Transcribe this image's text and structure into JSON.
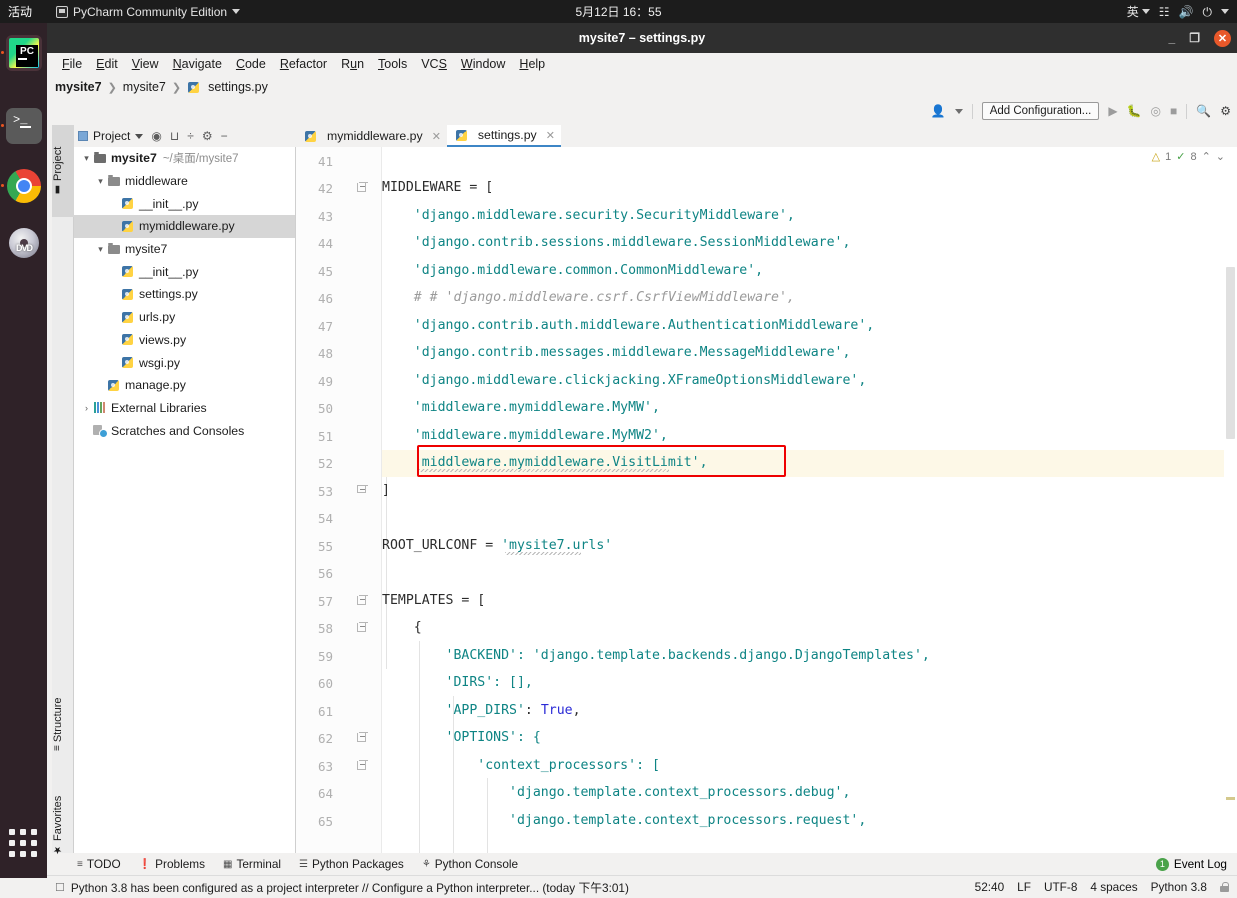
{
  "gnome": {
    "activities": "活动",
    "app_name": "PyCharm Community Edition",
    "clock": "5月12日 16：55",
    "input_method": "英",
    "icons": [
      "network-icon",
      "volume-icon",
      "power-icon"
    ]
  },
  "dock": {
    "items": [
      {
        "name": "pycharm",
        "label": "PC"
      },
      {
        "name": "terminal",
        "label": ">_"
      },
      {
        "name": "chrome",
        "label": ""
      },
      {
        "name": "dvd",
        "label": "DVD"
      }
    ],
    "show_apps": "show-applications"
  },
  "window": {
    "title": "mysite7 – settings.py",
    "minimize": "_",
    "maximize": "❐",
    "close": "✕"
  },
  "menubar": [
    {
      "label": "File",
      "mnemonic": "F"
    },
    {
      "label": "Edit",
      "mnemonic": "E"
    },
    {
      "label": "View",
      "mnemonic": "V"
    },
    {
      "label": "Navigate",
      "mnemonic": "N"
    },
    {
      "label": "Code",
      "mnemonic": "C"
    },
    {
      "label": "Refactor",
      "mnemonic": "R"
    },
    {
      "label": "Run",
      "mnemonic": "u"
    },
    {
      "label": "Tools",
      "mnemonic": "T"
    },
    {
      "label": "VCS",
      "mnemonic": "S"
    },
    {
      "label": "Window",
      "mnemonic": "W"
    },
    {
      "label": "Help",
      "mnemonic": "H"
    }
  ],
  "breadcrumb": [
    "mysite7",
    "mysite7",
    "settings.py"
  ],
  "toolbar": {
    "add_configuration": "Add Configuration...",
    "icons": [
      "user-avatar-icon",
      "run-icon",
      "debug-icon",
      "coverage-icon",
      "stop-icon",
      "search-icon",
      "settings-gear-icon"
    ]
  },
  "project_panel": {
    "title": "Project",
    "header_icons": [
      "locate-icon",
      "collapse-all-icon",
      "expand-icon",
      "gear-icon",
      "hide-icon"
    ],
    "tree": [
      {
        "label": "mysite7",
        "path": "~/桌面/mysite7",
        "icon": "folder-icon",
        "indent": 0,
        "arrow": "▾",
        "bold": true,
        "selected": false
      },
      {
        "label": "middleware",
        "path": "",
        "icon": "folder-icon",
        "indent": 1,
        "arrow": "▾",
        "bold": false,
        "selected": false
      },
      {
        "label": "__init__.py",
        "path": "",
        "icon": "python-file-icon",
        "indent": 2,
        "arrow": "",
        "bold": false,
        "selected": false
      },
      {
        "label": "mymiddleware.py",
        "path": "",
        "icon": "python-file-icon",
        "indent": 2,
        "arrow": "",
        "bold": false,
        "selected": true
      },
      {
        "label": "mysite7",
        "path": "",
        "icon": "folder-icon",
        "indent": 1,
        "arrow": "▾",
        "bold": false,
        "selected": false
      },
      {
        "label": "__init__.py",
        "path": "",
        "icon": "python-file-icon",
        "indent": 2,
        "arrow": "",
        "bold": false,
        "selected": false
      },
      {
        "label": "settings.py",
        "path": "",
        "icon": "python-file-icon",
        "indent": 2,
        "arrow": "",
        "bold": false,
        "selected": false
      },
      {
        "label": "urls.py",
        "path": "",
        "icon": "python-file-icon",
        "indent": 2,
        "arrow": "",
        "bold": false,
        "selected": false
      },
      {
        "label": "views.py",
        "path": "",
        "icon": "python-file-icon",
        "indent": 2,
        "arrow": "",
        "bold": false,
        "selected": false
      },
      {
        "label": "wsgi.py",
        "path": "",
        "icon": "python-file-icon",
        "indent": 2,
        "arrow": "",
        "bold": false,
        "selected": false
      },
      {
        "label": "manage.py",
        "path": "",
        "icon": "python-file-icon",
        "indent": 1,
        "arrow": "",
        "bold": false,
        "selected": false
      },
      {
        "label": "External Libraries",
        "path": "",
        "icon": "library-icon",
        "indent": 0,
        "arrow": "›",
        "bold": false,
        "selected": false
      },
      {
        "label": "Scratches and Consoles",
        "path": "",
        "icon": "scratch-icon",
        "indent": 0,
        "arrow": "",
        "bold": false,
        "selected": false
      }
    ]
  },
  "tool_tabs_left": [
    "Project",
    "Structure",
    "Favorites"
  ],
  "editor": {
    "tabs": [
      {
        "label": "mymiddleware.py",
        "active": false
      },
      {
        "label": "settings.py",
        "active": true
      }
    ],
    "inspections": {
      "warning_count": "1",
      "ok_count": "8",
      "up": "⌃",
      "down": "⌄"
    },
    "first_line": 41,
    "lines": [
      {
        "n": 41,
        "text": "",
        "type": "plain"
      },
      {
        "n": 42,
        "text": "MIDDLEWARE = [",
        "type": "plain",
        "fold": "start"
      },
      {
        "n": 43,
        "text": "    'django.middleware.security.SecurityMiddleware',",
        "type": "string-item"
      },
      {
        "n": 44,
        "text": "    'django.contrib.sessions.middleware.SessionMiddleware',",
        "type": "string-item"
      },
      {
        "n": 45,
        "text": "    'django.middleware.common.CommonMiddleware',",
        "type": "string-item"
      },
      {
        "n": 46,
        "text": "    # # 'django.middleware.csrf.CsrfViewMiddleware',",
        "type": "comment"
      },
      {
        "n": 47,
        "text": "    'django.contrib.auth.middleware.AuthenticationMiddleware',",
        "type": "string-item"
      },
      {
        "n": 48,
        "text": "    'django.contrib.messages.middleware.MessageMiddleware',",
        "type": "string-item"
      },
      {
        "n": 49,
        "text": "    'django.middleware.clickjacking.XFrameOptionsMiddleware',",
        "type": "string-item"
      },
      {
        "n": 50,
        "text": "    'middleware.mymiddleware.MyMW',",
        "type": "string-item"
      },
      {
        "n": 51,
        "text": "    'middleware.mymiddleware.MyMW2',",
        "type": "string-item"
      },
      {
        "n": 52,
        "text": "    'middleware.mymiddleware.VisitLimit',",
        "type": "string-item",
        "highlighted": true,
        "bulb": true,
        "boxed": true
      },
      {
        "n": 53,
        "text": "]",
        "type": "plain",
        "fold": "end"
      },
      {
        "n": 54,
        "text": "",
        "type": "plain"
      },
      {
        "n": 55,
        "text": "ROOT_URLCONF = 'mysite7.urls'",
        "type": "assign-string"
      },
      {
        "n": 56,
        "text": "",
        "type": "plain"
      },
      {
        "n": 57,
        "text": "TEMPLATES = [",
        "type": "plain",
        "fold": "start"
      },
      {
        "n": 58,
        "text": "    {",
        "type": "plain",
        "fold": "start"
      },
      {
        "n": 59,
        "text": "        'BACKEND': 'django.template.backends.django.DjangoTemplates',",
        "type": "string-item"
      },
      {
        "n": 60,
        "text": "        'DIRS': [],",
        "type": "string-item"
      },
      {
        "n": 61,
        "text": "        'APP_DIRS': True,",
        "type": "kw-line"
      },
      {
        "n": 62,
        "text": "        'OPTIONS': {",
        "type": "string-item",
        "fold": "start"
      },
      {
        "n": 63,
        "text": "            'context_processors': [",
        "type": "string-item",
        "fold": "start"
      },
      {
        "n": 64,
        "text": "                'django.template.context_processors.debug',",
        "type": "string-item"
      },
      {
        "n": 65,
        "text": "                'django.template.context_processors.request',",
        "type": "string-item"
      }
    ]
  },
  "bottom_tools": [
    {
      "label": "TODO",
      "icon": "todo-icon"
    },
    {
      "label": "Problems",
      "icon": "problems-icon"
    },
    {
      "label": "Terminal",
      "icon": "terminal-icon"
    },
    {
      "label": "Python Packages",
      "icon": "packages-icon"
    },
    {
      "label": "Python Console",
      "icon": "console-icon"
    }
  ],
  "event_log": {
    "label": "Event Log",
    "badge": "1"
  },
  "status": {
    "message": "Python 3.8 has been configured as a project interpreter // Configure a Python interpreter... (today 下午3:01)",
    "caret": "52:40",
    "line_sep": "LF",
    "encoding": "UTF-8",
    "indent": "4 spaces",
    "interpreter": "Python 3.8",
    "lock": "lock-icon"
  }
}
